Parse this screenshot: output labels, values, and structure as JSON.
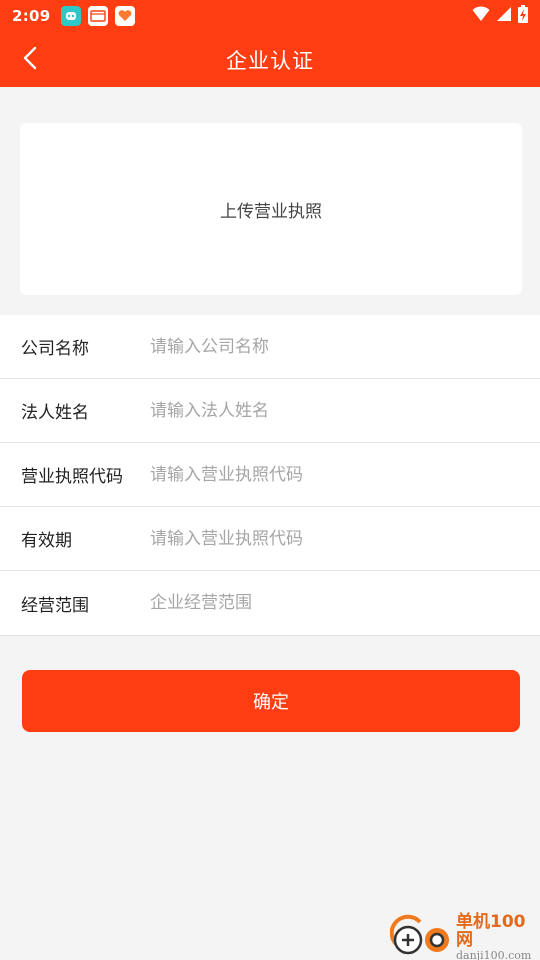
{
  "status_bar": {
    "time": "2:09",
    "notification_icons": [
      "app-icon-robot",
      "app-icon-window",
      "app-icon-heart"
    ],
    "right_icons": [
      "wifi-icon",
      "signal-icon",
      "battery-charging-icon"
    ]
  },
  "header": {
    "title": "企业认证",
    "back_icon": "chevron-left-icon"
  },
  "upload": {
    "label": "上传营业执照"
  },
  "form": {
    "fields": [
      {
        "label": "公司名称",
        "placeholder": "请输入公司名称",
        "value": ""
      },
      {
        "label": "法人姓名",
        "placeholder": "请输入法人姓名",
        "value": ""
      },
      {
        "label": "营业执照代码",
        "placeholder": "请输入营业执照代码",
        "value": ""
      },
      {
        "label": "有效期",
        "placeholder": "请输入营业执照代码",
        "value": ""
      },
      {
        "label": "经营范围",
        "placeholder": "企业经营范围",
        "value": ""
      }
    ]
  },
  "actions": {
    "confirm_label": "确定"
  },
  "watermark": {
    "name": "单机100网",
    "url": "danji100.com"
  },
  "colors": {
    "accent": "#ff3d12",
    "background": "#f4f4f4",
    "placeholder": "#a6a6a6"
  }
}
